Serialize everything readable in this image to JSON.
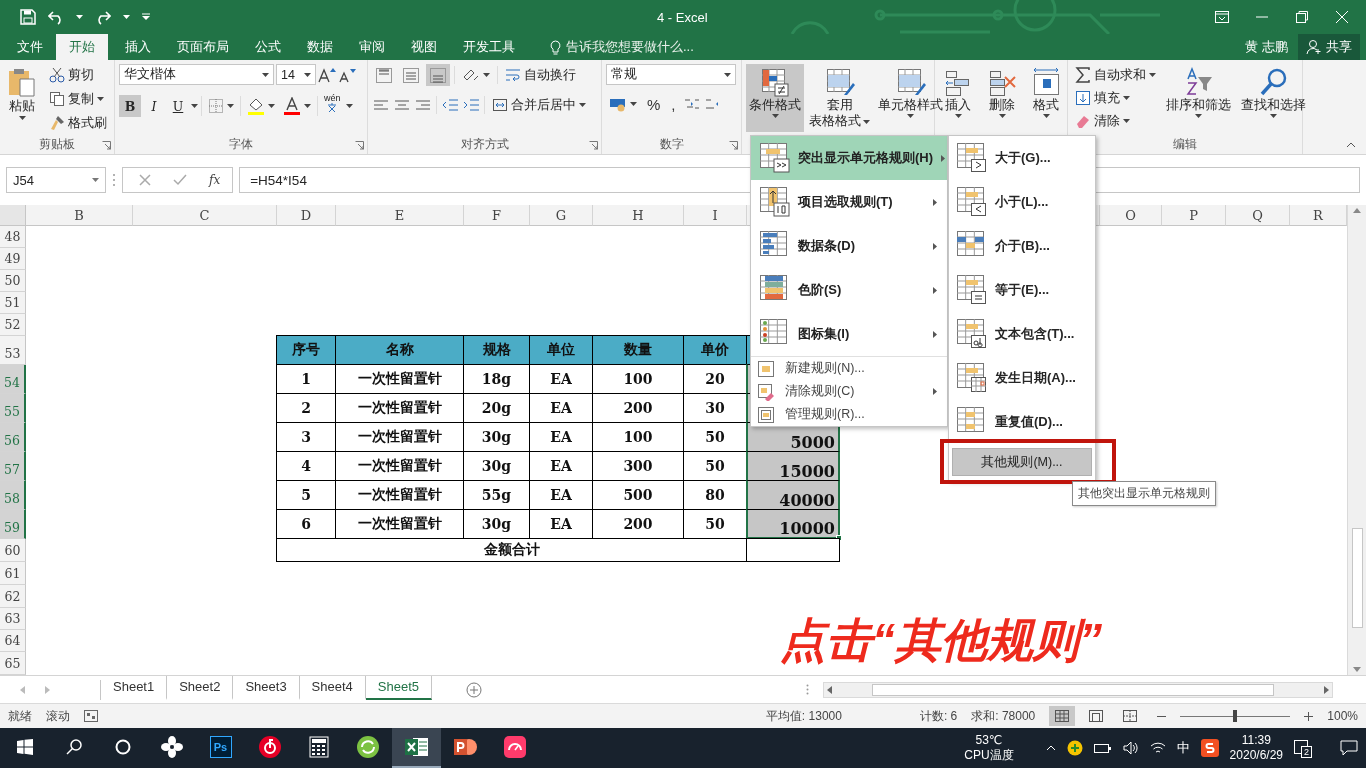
{
  "title_bar": {
    "title": "4 - Excel"
  },
  "tabs": [
    {
      "label": "文件",
      "selected": false
    },
    {
      "label": "开始",
      "selected": true
    },
    {
      "label": "插入",
      "selected": false
    },
    {
      "label": "页面布局",
      "selected": false
    },
    {
      "label": "公式",
      "selected": false
    },
    {
      "label": "数据",
      "selected": false
    },
    {
      "label": "审阅",
      "selected": false
    },
    {
      "label": "视图",
      "selected": false
    },
    {
      "label": "开发工具",
      "selected": false
    }
  ],
  "tell_me": {
    "placeholder": "告诉我您想要做什么..."
  },
  "user": "黄 志鹏",
  "share_button": "共享",
  "ribbon": {
    "groups": [
      {
        "kind": "clipboard",
        "label": "剪贴板",
        "paste": "粘贴",
        "actions": [
          "剪切",
          "复制",
          "格式刷"
        ]
      },
      {
        "kind": "font",
        "label": "字体",
        "font_name": "华文楷体",
        "font_size": "14",
        "styles": [
          {
            "label": "B",
            "selected": true
          },
          {
            "label": "I",
            "selected": false
          },
          {
            "label": "U",
            "selected": false
          }
        ],
        "phonetic": "wén"
      },
      {
        "kind": "alignment",
        "label": "对齐方式",
        "vertical": [
          {
            "selected": false
          },
          {
            "selected": false
          },
          {
            "selected": true
          }
        ],
        "wrap": "自动换行",
        "merge": "合并后居中"
      },
      {
        "kind": "number",
        "label": "数字",
        "format": "常规",
        "symbols": [
          "%",
          ","
        ]
      },
      {
        "kind": "styles",
        "buttons": [
          {
            "lines": [
              "条件格式"
            ],
            "selected": true
          },
          {
            "lines": [
              "套用",
              "表格格式"
            ],
            "selected": false
          },
          {
            "lines": [
              "单元格样式"
            ],
            "selected": false
          }
        ]
      },
      {
        "kind": "cells",
        "buttons": [
          {
            "lines": [
              "插入"
            ]
          },
          {
            "lines": [
              "删除"
            ]
          },
          {
            "lines": [
              "格式"
            ]
          }
        ]
      },
      {
        "kind": "editing",
        "label": "编辑",
        "actions": [
          "自动求和",
          "填充",
          "清除"
        ],
        "buttons": [
          "排序和筛选",
          "查找和选择"
        ]
      }
    ]
  },
  "formula_bar": {
    "name_box": "J54",
    "function_label": "fx",
    "formula": "=H54*I54"
  },
  "grid": {
    "columns": [
      "B",
      "C",
      "D",
      "E",
      "F",
      "G",
      "H",
      "I",
      "O",
      "P",
      "Q",
      "R"
    ],
    "rows": [
      {
        "label": "48",
        "selected": false
      },
      {
        "label": "49",
        "selected": false
      },
      {
        "label": "50",
        "selected": false
      },
      {
        "label": "51",
        "selected": false
      },
      {
        "label": "52",
        "selected": false
      },
      {
        "label": "53",
        "selected": false
      },
      {
        "label": "54",
        "selected": true
      },
      {
        "label": "55",
        "selected": true
      },
      {
        "label": "56",
        "selected": true
      },
      {
        "label": "57",
        "selected": true
      },
      {
        "label": "58",
        "selected": true
      },
      {
        "label": "59",
        "selected": true
      },
      {
        "label": "60",
        "selected": false
      },
      {
        "label": "61",
        "selected": false
      },
      {
        "label": "62",
        "selected": false
      },
      {
        "label": "63",
        "selected": false
      },
      {
        "label": "64",
        "selected": false
      },
      {
        "label": "65",
        "selected": false
      }
    ]
  },
  "table": {
    "header": [
      "序号",
      "名称",
      "规格",
      "单位",
      "数量",
      "单价"
    ],
    "rows": [
      {
        "cells": [
          "1",
          "一次性留置针",
          "18g",
          "EA",
          "100",
          "20"
        ],
        "selected": true
      },
      {
        "cells": [
          "2",
          "一次性留置针",
          "20g",
          "EA",
          "200",
          "30"
        ],
        "selected": true
      },
      {
        "cells": [
          "3",
          "一次性留置针",
          "30g",
          "EA",
          "100",
          "50"
        ],
        "amount": "5000",
        "selected": true
      },
      {
        "cells": [
          "4",
          "一次性留置针",
          "30g",
          "EA",
          "300",
          "50"
        ],
        "amount": "15000",
        "selected": true
      },
      {
        "cells": [
          "5",
          "一次性留置针",
          "55g",
          "EA",
          "500",
          "80"
        ],
        "amount": "40000",
        "selected": true
      },
      {
        "cells": [
          "6",
          "一次性留置针",
          "30g",
          "EA",
          "200",
          "50"
        ],
        "amount": "10000",
        "selected": true
      }
    ],
    "total_label": "金额合计"
  },
  "cf_menu": {
    "items": [
      {
        "label": "突出显示单元格规则(H)",
        "kind": "highlight",
        "submenu": true,
        "selected": true
      },
      {
        "label": "项目选取规则(T)",
        "kind": "topbottom",
        "submenu": true,
        "selected": false
      },
      {
        "label": "数据条(D)",
        "kind": "databar",
        "submenu": true,
        "selected": false
      },
      {
        "label": "色阶(S)",
        "kind": "colorscale",
        "submenu": true,
        "selected": false
      },
      {
        "label": "图标集(I)",
        "kind": "iconset",
        "submenu": true,
        "selected": false
      },
      {
        "label": "新建规则(N)...",
        "kind": "new",
        "submenu": false,
        "selected": false
      },
      {
        "label": "清除规则(C)",
        "kind": "clear",
        "submenu": true,
        "selected": false
      },
      {
        "label": "管理规则(R)...",
        "kind": "manage",
        "submenu": false,
        "selected": false
      }
    ]
  },
  "rule_submenu": {
    "items": [
      {
        "label": "大于(G)...",
        "kind": "greater"
      },
      {
        "label": "小于(L)...",
        "kind": "less"
      },
      {
        "label": "介于(B)...",
        "kind": "between"
      },
      {
        "label": "等于(E)...",
        "kind": "equal"
      },
      {
        "label": "文本包含(T)...",
        "kind": "text"
      },
      {
        "label": "发生日期(A)...",
        "kind": "date"
      },
      {
        "label": "重复值(D)...",
        "kind": "duplicate"
      }
    ],
    "more_rules": {
      "label": "其他规则(M)...",
      "selected": true
    }
  },
  "tooltip": "其他突出显示单元格规则",
  "annotation": "点击“其他规则”",
  "sheet_tabs": [
    {
      "label": "Sheet1",
      "selected": false
    },
    {
      "label": "Sheet2",
      "selected": false
    },
    {
      "label": "Sheet3",
      "selected": false
    },
    {
      "label": "Sheet4",
      "selected": false
    },
    {
      "label": "Sheet5",
      "selected": true
    }
  ],
  "status_bar": {
    "mode": "就绪",
    "scroll": "滚动",
    "average": "平均值: 13000",
    "count": "计数: 6",
    "sum": "求和: 78000",
    "views": [
      {
        "selected": true
      },
      {
        "selected": false
      },
      {
        "selected": false
      }
    ],
    "zoom_slider": {
      "level": 0.5
    },
    "zoom": "100%"
  },
  "taskbar": {
    "apps": [
      {
        "kind": "windows",
        "selected": false
      },
      {
        "kind": "search",
        "selected": false
      },
      {
        "kind": "cortana",
        "selected": false
      },
      {
        "kind": "fan",
        "selected": false
      },
      {
        "kind": "ps",
        "label": "Ps",
        "selected": false
      },
      {
        "kind": "netease",
        "selected": false
      },
      {
        "kind": "calculator",
        "selected": false
      },
      {
        "kind": "refresh",
        "selected": false
      },
      {
        "kind": "excel",
        "selected": true
      },
      {
        "kind": "powerpoint",
        "selected": false
      },
      {
        "kind": "monitor",
        "selected": false
      }
    ],
    "temperature": "53℃",
    "sensor": "CPU温度",
    "ime": "中",
    "time": "11:39",
    "date": "2020/6/29",
    "notifications": "2"
  }
}
